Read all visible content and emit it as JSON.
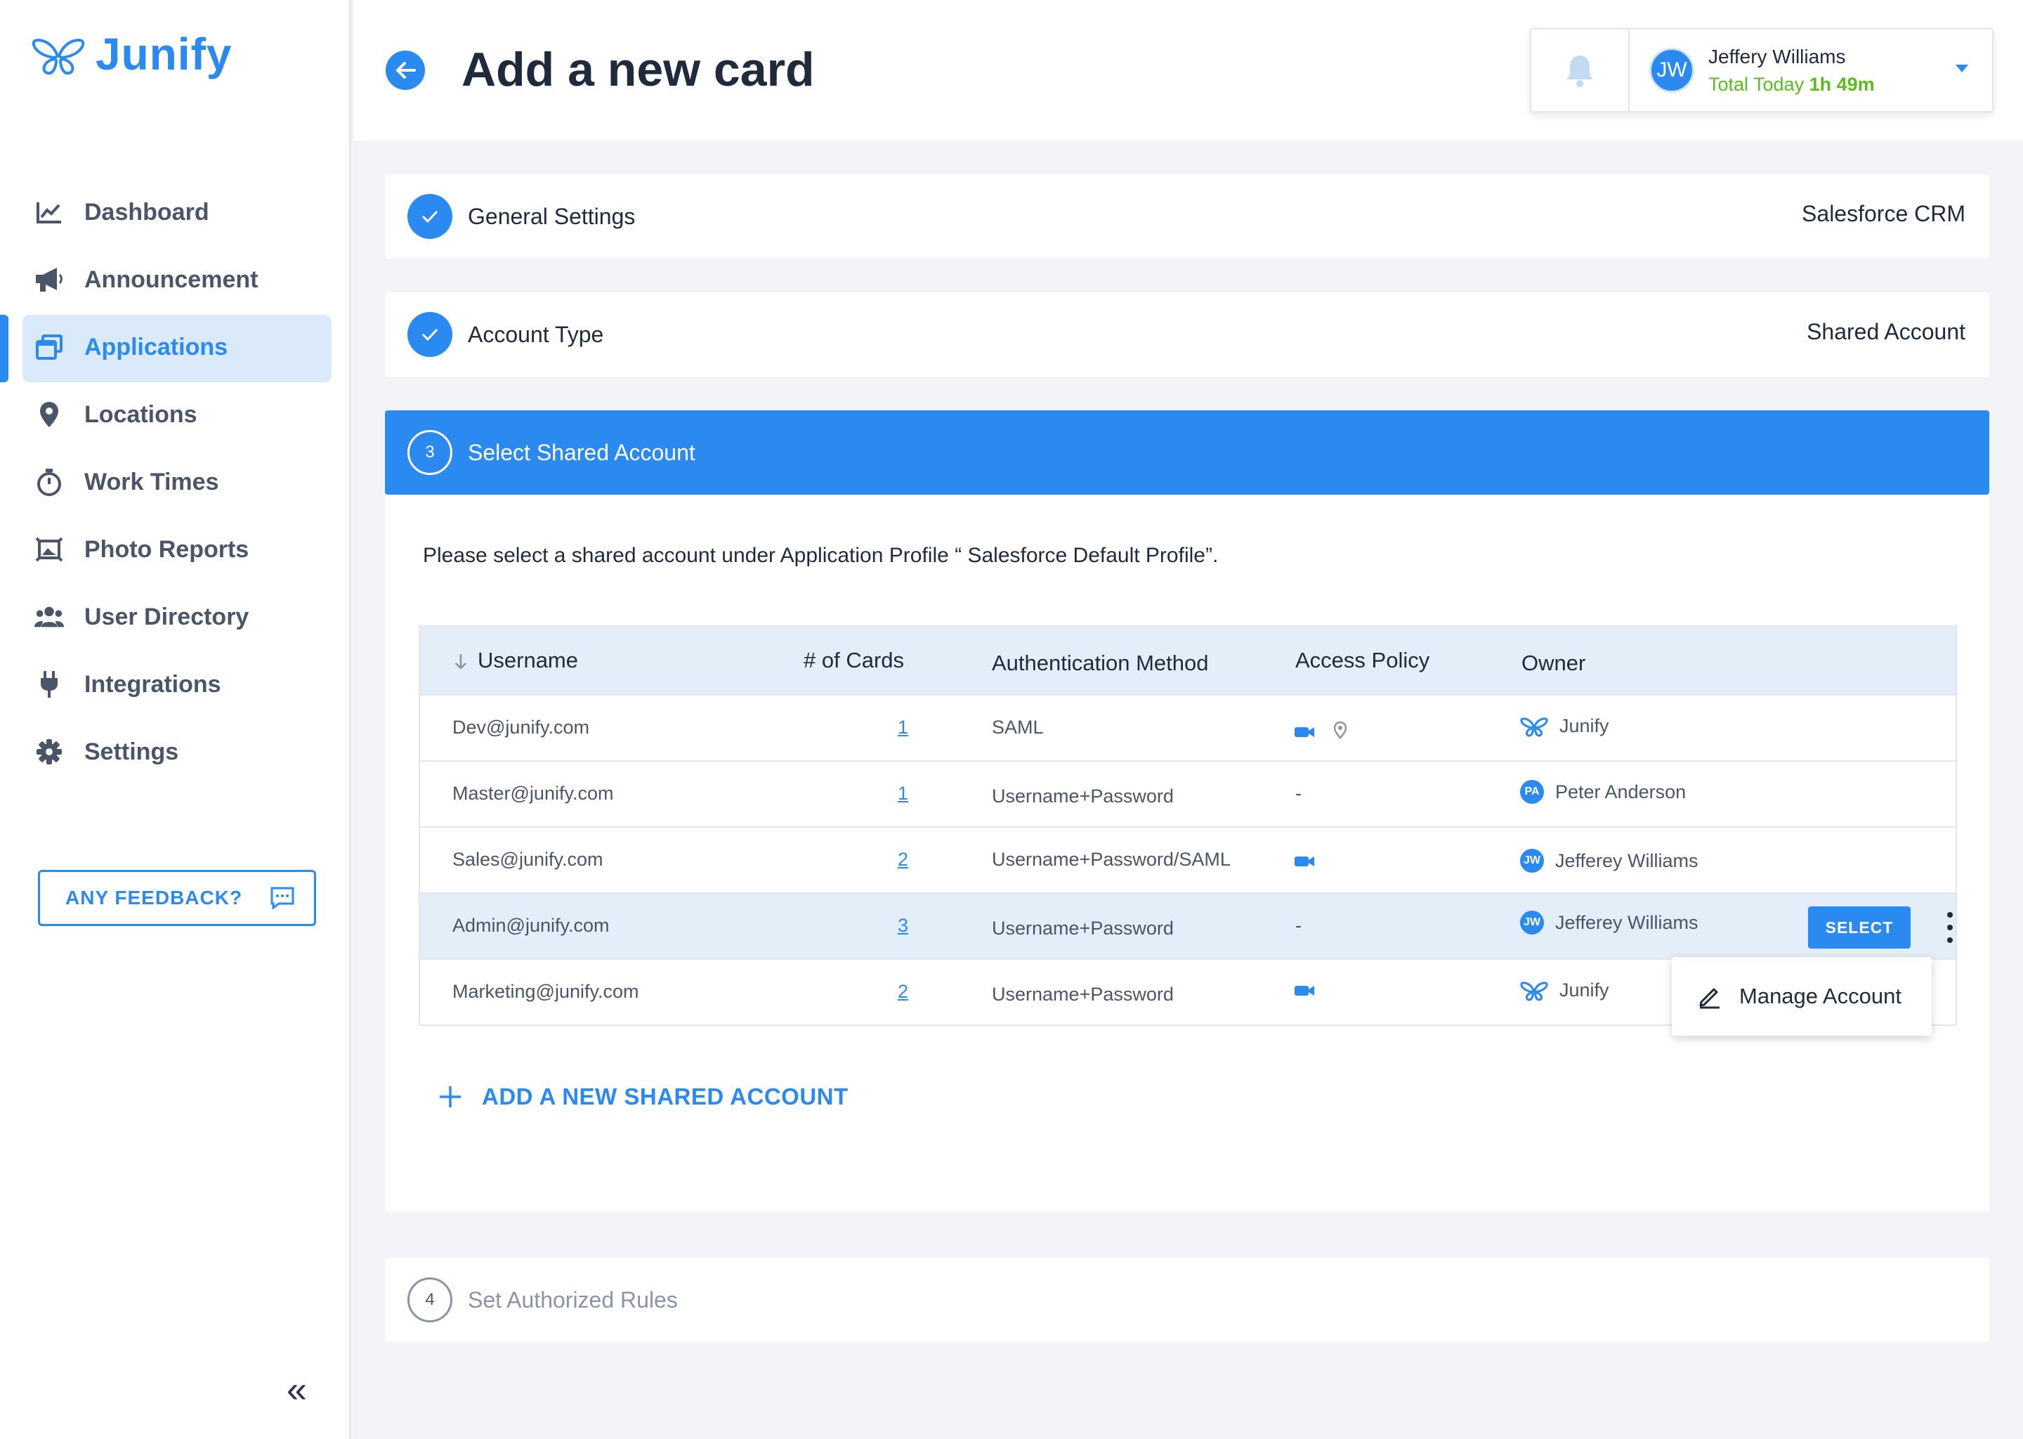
{
  "app": {
    "brand": "Junify",
    "colors": {
      "accent": "#2b8af0",
      "success": "#5dbb1e",
      "highlight": "#e4eef9"
    }
  },
  "sidebar": {
    "items": [
      {
        "label": "Dashboard",
        "icon": "chart-icon"
      },
      {
        "label": "Announcement",
        "icon": "megaphone-icon"
      },
      {
        "label": "Applications",
        "icon": "windows-icon",
        "active": true
      },
      {
        "label": "Locations",
        "icon": "location-pin-icon"
      },
      {
        "label": "Work Times",
        "icon": "stopwatch-icon"
      },
      {
        "label": "Photo Reports",
        "icon": "photo-frame-icon"
      },
      {
        "label": "User Directory",
        "icon": "users-icon"
      },
      {
        "label": "Integrations",
        "icon": "plug-icon"
      },
      {
        "label": "Settings",
        "icon": "gear-icon"
      }
    ],
    "feedback_label": "ANY FEEDBACK?",
    "collapse_label": "«"
  },
  "header": {
    "title": "Add a new card",
    "user": {
      "initials": "JW",
      "name": "Jeffery Williams",
      "time_label": "Total Today",
      "time_value": "1h 49m"
    }
  },
  "steps": [
    {
      "title": "General Settings",
      "value": "Salesforce CRM",
      "state": "done"
    },
    {
      "title": "Account Type",
      "value": "Shared Account",
      "state": "done"
    },
    {
      "number": "3",
      "title": "Select Shared Account",
      "state": "active"
    },
    {
      "number": "4",
      "title": "Set Authorized Rules",
      "state": "pending"
    }
  ],
  "panel": {
    "instruction": "Please select a shared account under Application Profile “ Salesforce Default Profile”.",
    "columns": {
      "username": "Username",
      "cards": "# of Cards",
      "auth": "Authentication Method",
      "policy": "Access Policy",
      "owner": "Owner"
    },
    "rows": [
      {
        "username": "Dev@junify.com",
        "cards": "1",
        "auth": "SAML",
        "policy": "",
        "owner": "Junify",
        "owner_type": "logo",
        "policy_icons": [
          "video-icon",
          "location-pin-icon"
        ]
      },
      {
        "username": "Master@junify.com",
        "cards": "1",
        "auth": "Username+Password",
        "policy": "-",
        "owner": "Peter Anderson",
        "owner_type": "avatar",
        "owner_initials": "PA",
        "policy_icons": []
      },
      {
        "username": "Sales@junify.com",
        "cards": "2",
        "auth": "Username+Password/SAML",
        "policy": "",
        "owner": "Jefferey Williams",
        "owner_type": "avatar",
        "owner_initials": "JW",
        "policy_icons": [
          "video-icon"
        ]
      },
      {
        "username": "Admin@junify.com",
        "cards": "3",
        "auth": "Username+Password",
        "policy": "-",
        "owner": "Jefferey Williams",
        "owner_type": "avatar",
        "owner_initials": "JW",
        "policy_icons": [],
        "highlighted": true
      },
      {
        "username": "Marketing@junify.com",
        "cards": "2",
        "auth": "Username+Password",
        "policy": "",
        "owner": "Junify",
        "owner_type": "logo",
        "policy_icons": [
          "video-icon"
        ]
      }
    ],
    "select_label": "SELECT",
    "menu_label": "Manage Account",
    "add_label": "ADD A NEW SHARED ACCOUNT"
  }
}
